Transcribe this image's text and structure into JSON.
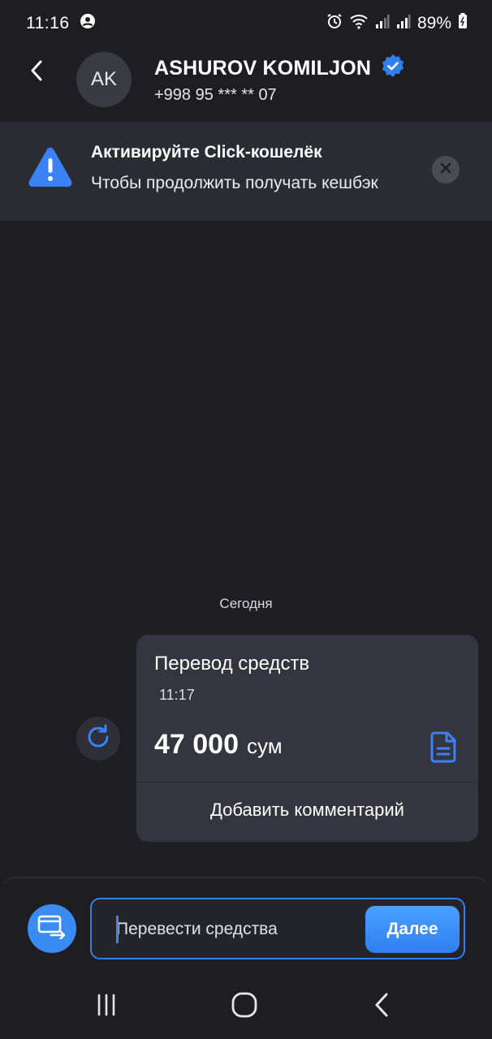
{
  "status_bar": {
    "time": "11:16",
    "battery": "89%",
    "icons": [
      "account-circle-icon",
      "alarm-icon",
      "wifi-icon",
      "signal-icon",
      "signal-icon",
      "battery-icon"
    ]
  },
  "header": {
    "back_icon": "chevron-left-icon",
    "avatar_initials": "AK",
    "name": "ASHUROV KOMILJON",
    "verified_icon": "verified-badge-icon",
    "phone": "+998 95 *** ** 07"
  },
  "banner": {
    "icon": "warning-triangle-icon",
    "title": "Активируйте Click-кошелёк",
    "subtitle": "Чтобы продолжить получать кешбэк",
    "close_icon": "close-icon"
  },
  "chat": {
    "date_label": "Сегодня",
    "retry_icon": "refresh-icon",
    "message": {
      "title": "Перевод средств",
      "time": "11:17",
      "amount": "47 000",
      "currency": "сум",
      "receipt_icon": "document-icon",
      "comment_action": "Добавить комментарий"
    }
  },
  "composer": {
    "transfer_icon": "card-transfer-icon",
    "placeholder": "Перевести средства",
    "submit_label": "Далее"
  },
  "nav_bar": {
    "recents_icon": "recents-icon",
    "home_icon": "home-icon",
    "back_icon": "back-icon"
  },
  "colors": {
    "background": "#1e1e22",
    "accent": "#3b82f6",
    "card": "#34353e",
    "banner": "#2b2c33"
  }
}
